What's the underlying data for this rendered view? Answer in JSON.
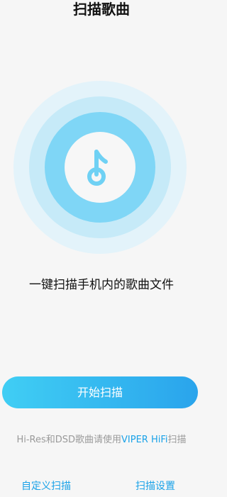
{
  "header": {
    "title": "扫描歌曲"
  },
  "main": {
    "icon": "music-note-icon",
    "description": "一键扫描手机内的歌曲文件",
    "start_button_label": "开始扫描"
  },
  "hint": {
    "prefix": "Hi-Res和DSD歌曲请使用",
    "link": "VIPER HiFi",
    "suffix": "扫描"
  },
  "footer": {
    "custom_scan_label": "自定义扫描",
    "scan_settings_label": "扫描设置"
  },
  "colors": {
    "accent": "#1aa2e8",
    "button_start": "#40cef4",
    "button_end": "#2aa4ec",
    "ring_outer": "#e3f3fa",
    "ring_middle": "#c6eaf8",
    "ring_inner": "#7fd6f6"
  }
}
